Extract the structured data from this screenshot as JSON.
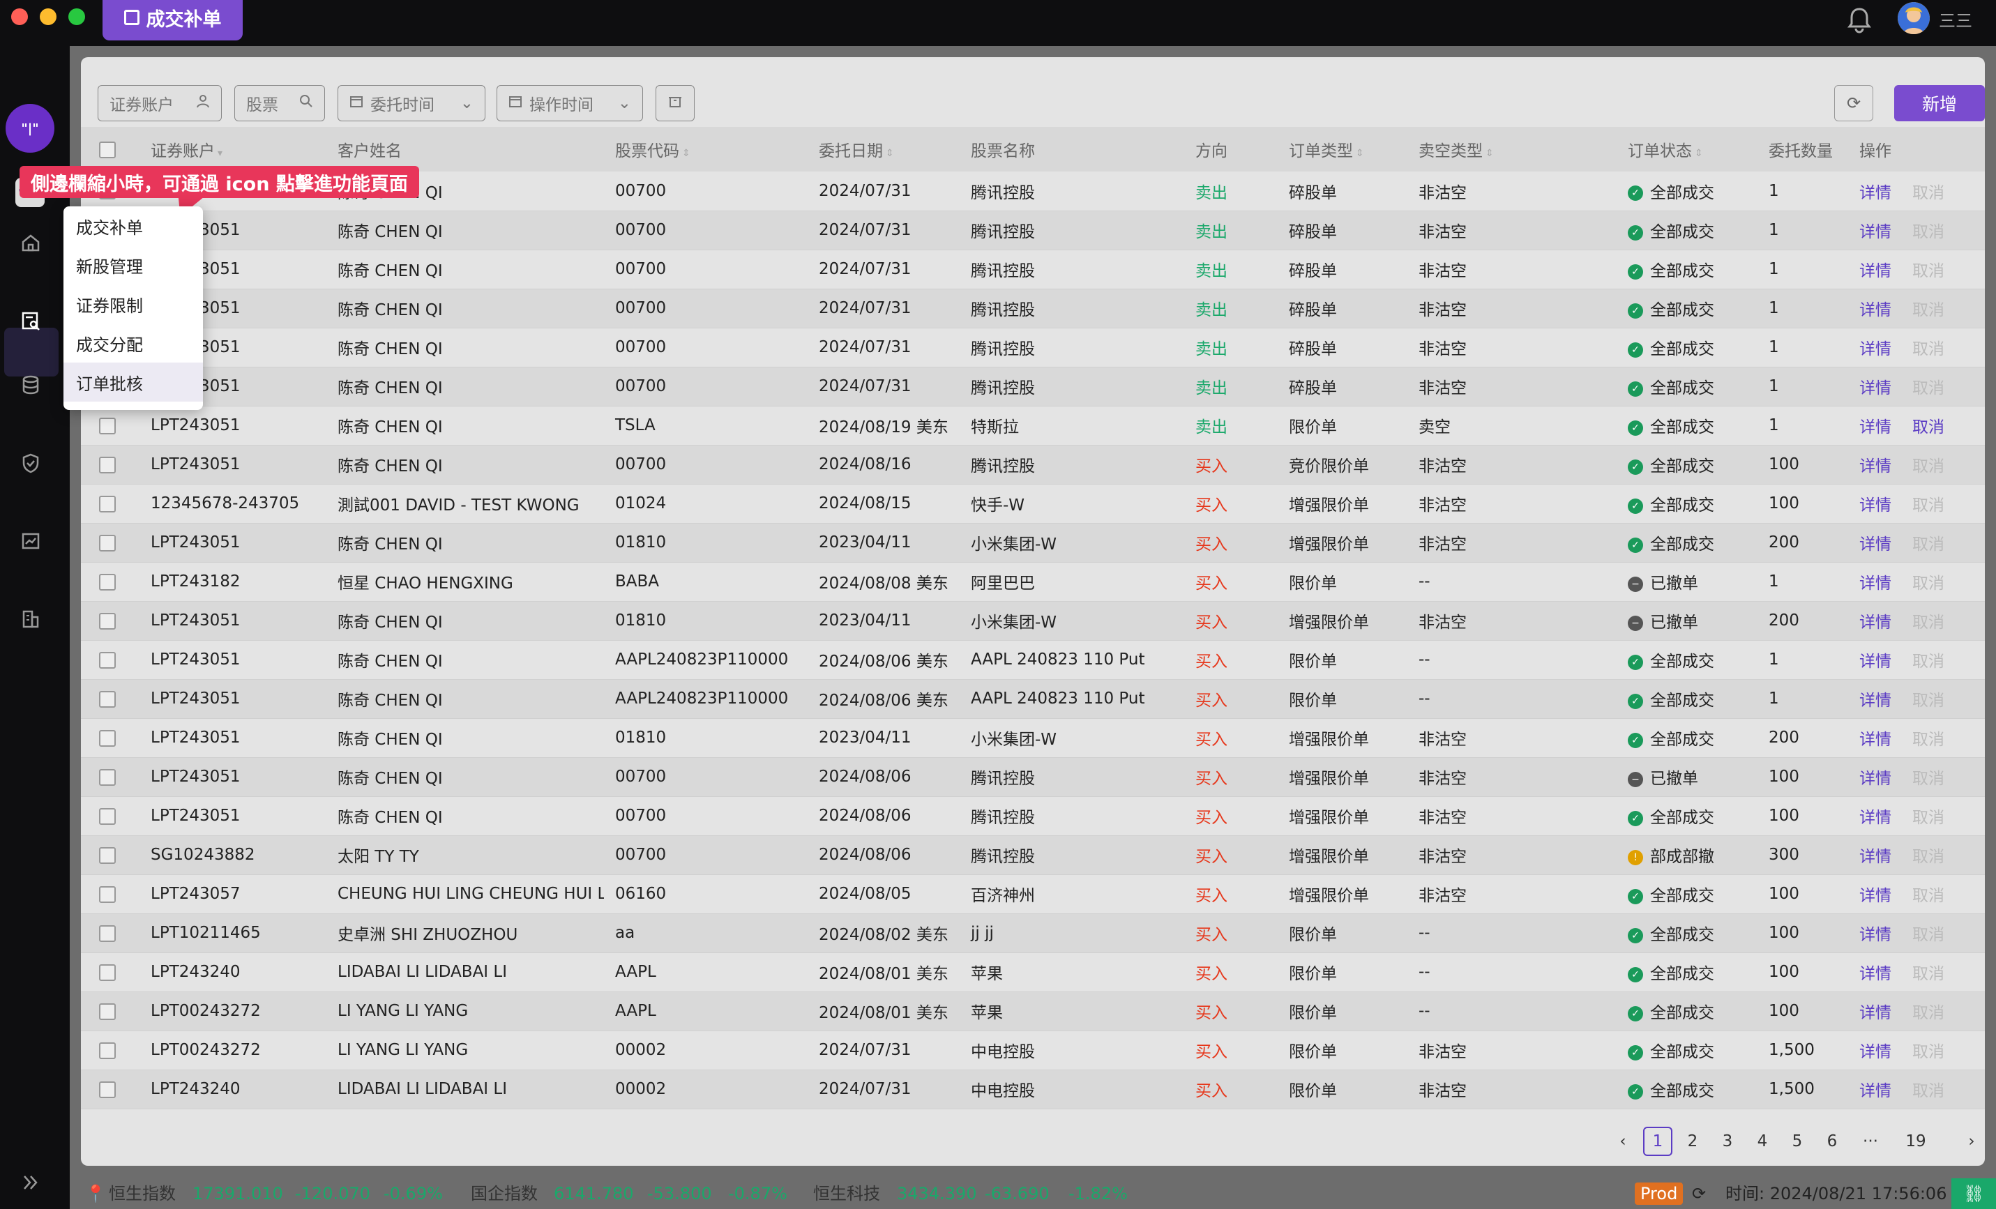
{
  "app": {
    "tab_title": "成交补单",
    "username": "三三"
  },
  "tooltip": "側邊欄縮小時，可通過 icon 點擊進功能頁面",
  "popup_menu": [
    "成交补单",
    "新股管理",
    "证券限制",
    "成交分配",
    "订单批核"
  ],
  "filters": {
    "account_placeholder": "证券账户",
    "stock_placeholder": "股票",
    "entrust_time": "委托时间",
    "operate_time": "操作时间"
  },
  "actions": {
    "new": "新增"
  },
  "columns": [
    "证券账户",
    "客户姓名",
    "股票代码",
    "委托日期",
    "股票名称",
    "方向",
    "订单类型",
    "卖空类型",
    "订单状态",
    "委托数量",
    "操作"
  ],
  "row_actions": {
    "detail": "详情",
    "cancel": "取消"
  },
  "rows": [
    {
      "account": "LPT243051",
      "name": "陈奇 CHEN QI",
      "code": "00700",
      "date": "2024/07/31",
      "stock": "腾讯控股",
      "dir": "卖出",
      "type": "碎股单",
      "short": "非沽空",
      "status": "全部成交",
      "st": "ok",
      "qty": "1",
      "cancel": false
    },
    {
      "account": "LPT243051",
      "name": "陈奇 CHEN QI",
      "code": "00700",
      "date": "2024/07/31",
      "stock": "腾讯控股",
      "dir": "卖出",
      "type": "碎股单",
      "short": "非沽空",
      "status": "全部成交",
      "st": "ok",
      "qty": "1",
      "cancel": false
    },
    {
      "account": "LPT243051",
      "name": "陈奇 CHEN QI",
      "code": "00700",
      "date": "2024/07/31",
      "stock": "腾讯控股",
      "dir": "卖出",
      "type": "碎股单",
      "short": "非沽空",
      "status": "全部成交",
      "st": "ok",
      "qty": "1",
      "cancel": false
    },
    {
      "account": "LPT243051",
      "name": "陈奇 CHEN QI",
      "code": "00700",
      "date": "2024/07/31",
      "stock": "腾讯控股",
      "dir": "卖出",
      "type": "碎股单",
      "short": "非沽空",
      "status": "全部成交",
      "st": "ok",
      "qty": "1",
      "cancel": false
    },
    {
      "account": "LPT243051",
      "name": "陈奇 CHEN QI",
      "code": "00700",
      "date": "2024/07/31",
      "stock": "腾讯控股",
      "dir": "卖出",
      "type": "碎股单",
      "short": "非沽空",
      "status": "全部成交",
      "st": "ok",
      "qty": "1",
      "cancel": false
    },
    {
      "account": "LPT243051",
      "name": "陈奇 CHEN QI",
      "code": "00700",
      "date": "2024/07/31",
      "stock": "腾讯控股",
      "dir": "卖出",
      "type": "碎股单",
      "short": "非沽空",
      "status": "全部成交",
      "st": "ok",
      "qty": "1",
      "cancel": false
    },
    {
      "account": "LPT243051",
      "name": "陈奇 CHEN QI",
      "code": "TSLA",
      "date": "2024/08/19 美东",
      "stock": "特斯拉",
      "dir": "卖出",
      "type": "限价单",
      "short": "卖空",
      "status": "全部成交",
      "st": "ok",
      "qty": "1",
      "cancel": true
    },
    {
      "account": "LPT243051",
      "name": "陈奇 CHEN QI",
      "code": "00700",
      "date": "2024/08/16",
      "stock": "腾讯控股",
      "dir": "买入",
      "type": "竞价限价单",
      "short": "非沽空",
      "status": "全部成交",
      "st": "ok",
      "qty": "100",
      "cancel": false
    },
    {
      "account": "12345678-243705",
      "name": "測試001 DAVID - TEST KWONG",
      "code": "01024",
      "date": "2024/08/15",
      "stock": "快手-W",
      "dir": "买入",
      "type": "增强限价单",
      "short": "非沽空",
      "status": "全部成交",
      "st": "ok",
      "qty": "100",
      "cancel": false
    },
    {
      "account": "LPT243051",
      "name": "陈奇 CHEN QI",
      "code": "01810",
      "date": "2023/04/11",
      "stock": "小米集团-W",
      "dir": "买入",
      "type": "增强限价单",
      "short": "非沽空",
      "status": "全部成交",
      "st": "ok",
      "qty": "200",
      "cancel": false
    },
    {
      "account": "LPT243182",
      "name": "恒星 CHAO HENGXING",
      "code": "BABA",
      "date": "2024/08/08 美东",
      "stock": "阿里巴巴",
      "dir": "买入",
      "type": "限价单",
      "short": "--",
      "status": "已撤单",
      "st": "cancel",
      "qty": "1",
      "cancel": false
    },
    {
      "account": "LPT243051",
      "name": "陈奇 CHEN QI",
      "code": "01810",
      "date": "2023/04/11",
      "stock": "小米集团-W",
      "dir": "买入",
      "type": "增强限价单",
      "short": "非沽空",
      "status": "已撤单",
      "st": "cancel",
      "qty": "200",
      "cancel": false
    },
    {
      "account": "LPT243051",
      "name": "陈奇 CHEN QI",
      "code": "AAPL240823P110000",
      "date": "2024/08/06 美东",
      "stock": "AAPL 240823 110 Put",
      "dir": "买入",
      "type": "限价单",
      "short": "--",
      "status": "全部成交",
      "st": "ok",
      "qty": "1",
      "cancel": false
    },
    {
      "account": "LPT243051",
      "name": "陈奇 CHEN QI",
      "code": "AAPL240823P110000",
      "date": "2024/08/06 美东",
      "stock": "AAPL 240823 110 Put",
      "dir": "买入",
      "type": "限价单",
      "short": "--",
      "status": "全部成交",
      "st": "ok",
      "qty": "1",
      "cancel": false
    },
    {
      "account": "LPT243051",
      "name": "陈奇 CHEN QI",
      "code": "01810",
      "date": "2023/04/11",
      "stock": "小米集团-W",
      "dir": "买入",
      "type": "增强限价单",
      "short": "非沽空",
      "status": "全部成交",
      "st": "ok",
      "qty": "200",
      "cancel": false
    },
    {
      "account": "LPT243051",
      "name": "陈奇 CHEN QI",
      "code": "00700",
      "date": "2024/08/06",
      "stock": "腾讯控股",
      "dir": "买入",
      "type": "增强限价单",
      "short": "非沽空",
      "status": "已撤单",
      "st": "cancel",
      "qty": "100",
      "cancel": false
    },
    {
      "account": "LPT243051",
      "name": "陈奇 CHEN QI",
      "code": "00700",
      "date": "2024/08/06",
      "stock": "腾讯控股",
      "dir": "买入",
      "type": "增强限价单",
      "short": "非沽空",
      "status": "全部成交",
      "st": "ok",
      "qty": "100",
      "cancel": false
    },
    {
      "account": "SG10243882",
      "name": "太阳 TY TY",
      "code": "00700",
      "date": "2024/08/06",
      "stock": "腾讯控股",
      "dir": "买入",
      "type": "增强限价单",
      "short": "非沽空",
      "status": "部成部撤",
      "st": "part",
      "qty": "300",
      "cancel": false
    },
    {
      "account": "LPT243057",
      "name": "CHEUNG HUI LING CHEUNG HUI L",
      "code": "06160",
      "date": "2024/08/05",
      "stock": "百济神州",
      "dir": "买入",
      "type": "增强限价单",
      "short": "非沽空",
      "status": "全部成交",
      "st": "ok",
      "qty": "100",
      "cancel": false
    },
    {
      "account": "LPT10211465",
      "name": "史卓洲 SHI ZHUOZHOU",
      "code": "aa",
      "date": "2024/08/02 美东",
      "stock": "jj jj",
      "dir": "买入",
      "type": "限价单",
      "short": "--",
      "status": "全部成交",
      "st": "ok",
      "qty": "100",
      "cancel": false
    },
    {
      "account": "LPT243240",
      "name": "LIDABAI LI LIDABAI LI",
      "code": "AAPL",
      "date": "2024/08/01 美东",
      "stock": "苹果",
      "dir": "买入",
      "type": "限价单",
      "short": "--",
      "status": "全部成交",
      "st": "ok",
      "qty": "100",
      "cancel": false
    },
    {
      "account": "LPT00243272",
      "name": "LI YANG LI YANG",
      "code": "AAPL",
      "date": "2024/08/01 美东",
      "stock": "苹果",
      "dir": "买入",
      "type": "限价单",
      "short": "--",
      "status": "全部成交",
      "st": "ok",
      "qty": "100",
      "cancel": false
    },
    {
      "account": "LPT00243272",
      "name": "LI YANG LI YANG",
      "code": "00002",
      "date": "2024/07/31",
      "stock": "中电控股",
      "dir": "买入",
      "type": "限价单",
      "short": "非沽空",
      "status": "全部成交",
      "st": "ok",
      "qty": "1,500",
      "cancel": false
    },
    {
      "account": "LPT243240",
      "name": "LIDABAI LI LIDABAI LI",
      "code": "00002",
      "date": "2024/07/31",
      "stock": "中电控股",
      "dir": "买入",
      "type": "限价单",
      "short": "非沽空",
      "status": "全部成交",
      "st": "ok",
      "qty": "1,500",
      "cancel": false
    }
  ],
  "pagination": {
    "pages": [
      "1",
      "2",
      "3",
      "4",
      "5",
      "6",
      "···",
      "19"
    ],
    "current": "1"
  },
  "statusbar": {
    "hsi_label": "恒生指数",
    "hsi_value": "17391.010",
    "hsi_change": "-120.070",
    "hsi_pct": "-0.69%",
    "hscei_label": "国企指数",
    "hscei_value": "6141.780",
    "hscei_change": "-53.800",
    "hscei_pct": "-0.87%",
    "hstech_label": "恒生科技",
    "hstech_value": "3434.390",
    "hstech_change": "-63.690",
    "hstech_pct": "-1.82%",
    "env": "Prod",
    "time_label": "时间: 2024/08/21 17:56:06"
  },
  "colors": {
    "accent": "#7a4ccf",
    "sell": "#1aa86a",
    "buy": "#e6361a",
    "tooltip": "#e8365a"
  }
}
